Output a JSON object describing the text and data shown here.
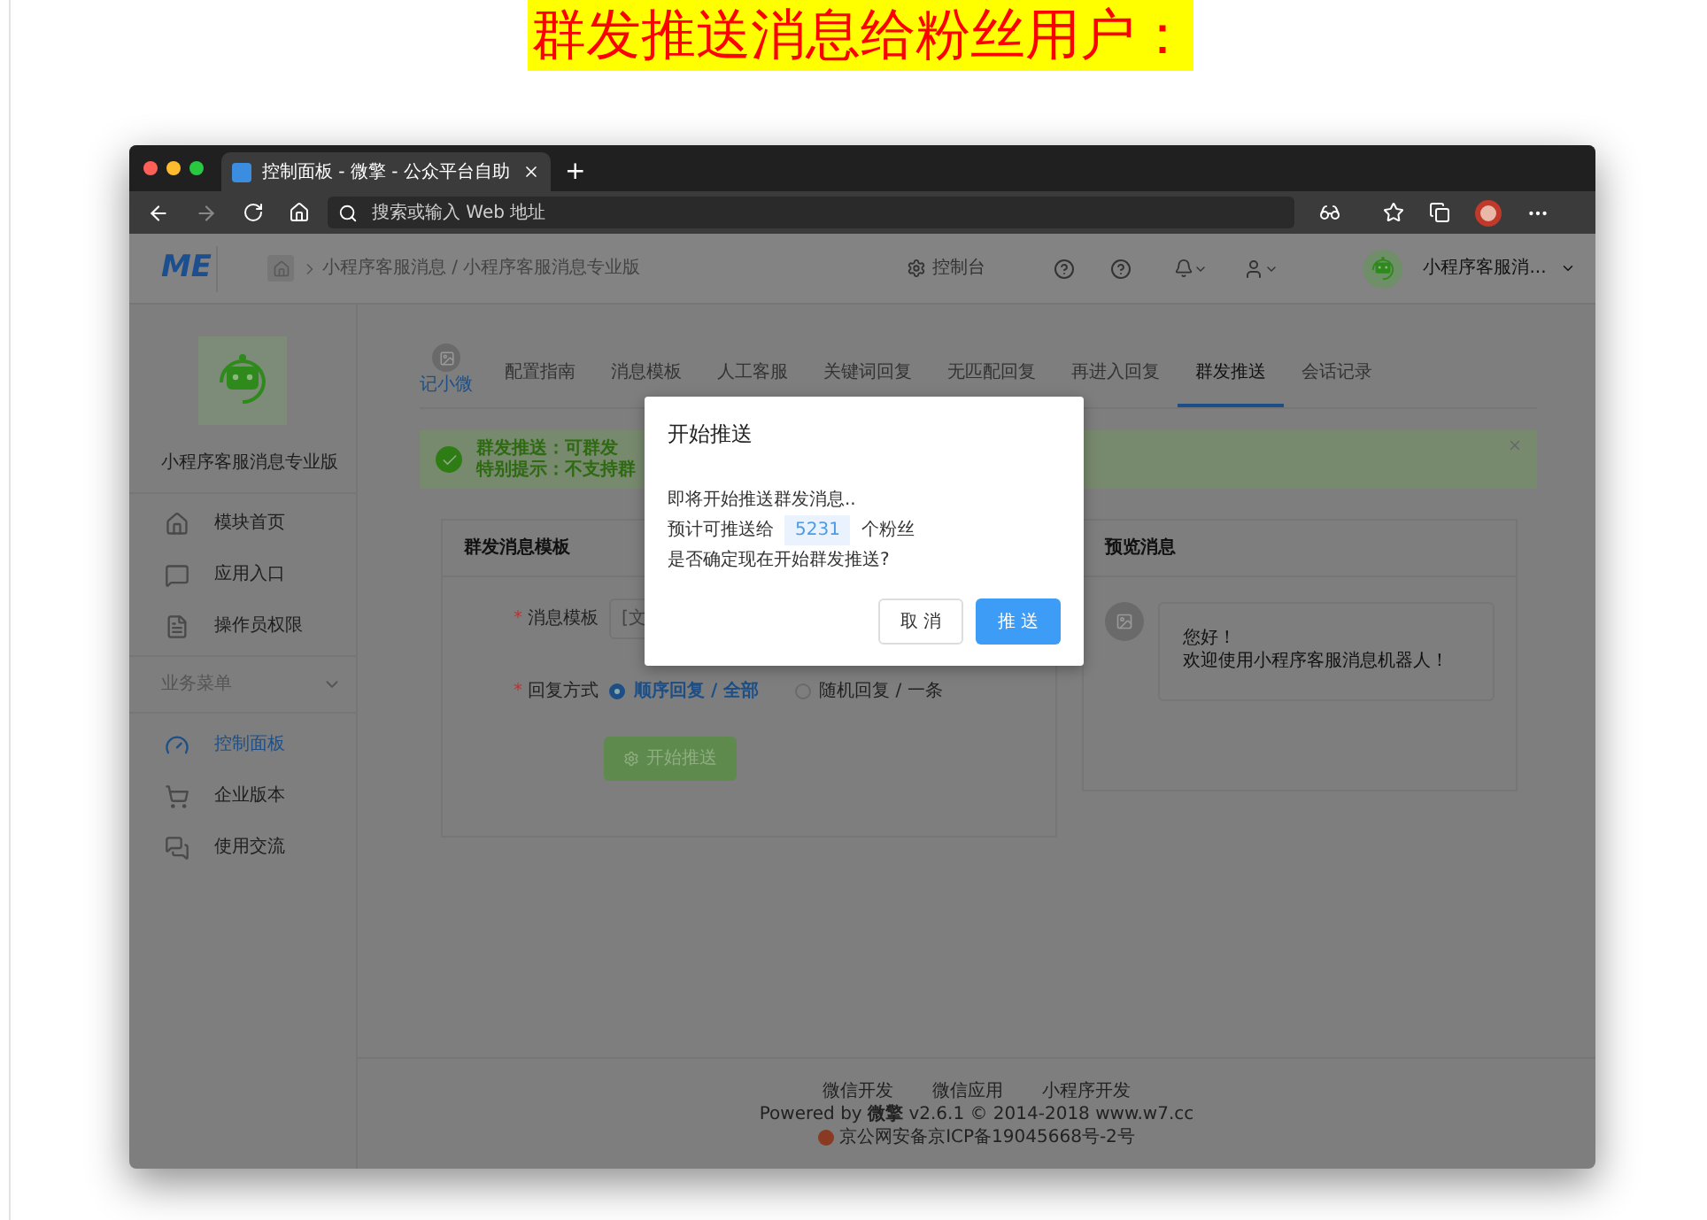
{
  "page_title": "群发推送消息给粉丝用户：",
  "browser": {
    "tab_title": "控制面板 - 微擎 - 公众平台自助",
    "new_tab": "+",
    "address_placeholder": "搜索或输入 Web 地址"
  },
  "header": {
    "logo": "ME",
    "breadcrumb": "小程序客服消息 / 小程序客服消息专业版",
    "console": "控制台",
    "account": "小程序客服消..."
  },
  "sidebar": {
    "app_name": "小程序客服消息专业版",
    "items": [
      {
        "label": "模块首页",
        "kind": "home",
        "selected": false
      },
      {
        "label": "应用入口",
        "kind": "chat",
        "selected": false
      },
      {
        "label": "操作员权限",
        "kind": "doc",
        "selected": false
      }
    ],
    "section": "业务菜单",
    "section_items": [
      {
        "label": "控制面板",
        "kind": "dashboard",
        "selected": true
      },
      {
        "label": "企业版本",
        "kind": "cart",
        "selected": false
      },
      {
        "label": "使用交流",
        "kind": "comments",
        "selected": false
      }
    ]
  },
  "tabs": {
    "badge": "记小微",
    "items": [
      {
        "label": "配置指南",
        "selected": false
      },
      {
        "label": "消息模板",
        "selected": false
      },
      {
        "label": "人工客服",
        "selected": false
      },
      {
        "label": "关键词回复",
        "selected": false
      },
      {
        "label": "无匹配回复",
        "selected": false
      },
      {
        "label": "再进入回复",
        "selected": false
      },
      {
        "label": "群发推送",
        "selected": true
      },
      {
        "label": "会话记录",
        "selected": false
      }
    ]
  },
  "alert": {
    "lines": [
      "群发推送：可群发",
      "特别提示：不支持群"
    ]
  },
  "form_card": {
    "title": "群发消息模板",
    "required_mark": "*",
    "template_label": "消息模板",
    "template_value": "[文",
    "mode_label": "回复方式",
    "modes": [
      {
        "label": "顺序回复 / 全部",
        "selected": true
      },
      {
        "label": "随机回复 / 一条",
        "selected": false
      }
    ],
    "submit": "开始推送"
  },
  "preview": {
    "title": "预览消息",
    "lines": [
      "您好！",
      "欢迎使用小程序客服消息机器人！"
    ]
  },
  "modal": {
    "title": "开始推送",
    "line1": "即将开始推送群发消息..",
    "line2_before": "预计可推送给",
    "count": "5231",
    "line2_after": "个粉丝",
    "line3": "是否确定现在开始群发推送?",
    "cancel": "取 消",
    "confirm": "推 送"
  },
  "footer": {
    "links": [
      "微信开发",
      "微信应用",
      "小程序开发"
    ],
    "powered": "Powered by **微擎** v2.6.1 © 2014-2018 www.w7.cc",
    "icp": "京公网安备京ICP备19045668号-2号"
  }
}
